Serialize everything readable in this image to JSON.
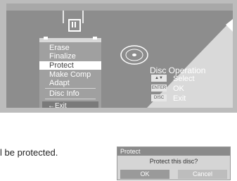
{
  "menu": {
    "items": [
      {
        "label": "Erase"
      },
      {
        "label": "Finalize"
      },
      {
        "label": "Protect",
        "selected": true
      },
      {
        "label": "Make Comp"
      },
      {
        "label": "Adapt"
      },
      {
        "label": "Disc Info"
      }
    ],
    "exit_label": "Exit"
  },
  "disc_operation": {
    "title": "Disc Operation",
    "legend": [
      {
        "key": "▲▼",
        "icon": "up-down-keys-icon",
        "label": "Select"
      },
      {
        "key": "ENTER",
        "icon": "enter-key-icon",
        "label": "OK"
      },
      {
        "key": "DISC",
        "icon": "disc-key-icon",
        "label": "Exit"
      }
    ]
  },
  "caption": "l be protected.",
  "dialog": {
    "title": "Protect",
    "message": "Protect this disc?",
    "ok_label": "OK",
    "cancel_label": "Cancel"
  }
}
